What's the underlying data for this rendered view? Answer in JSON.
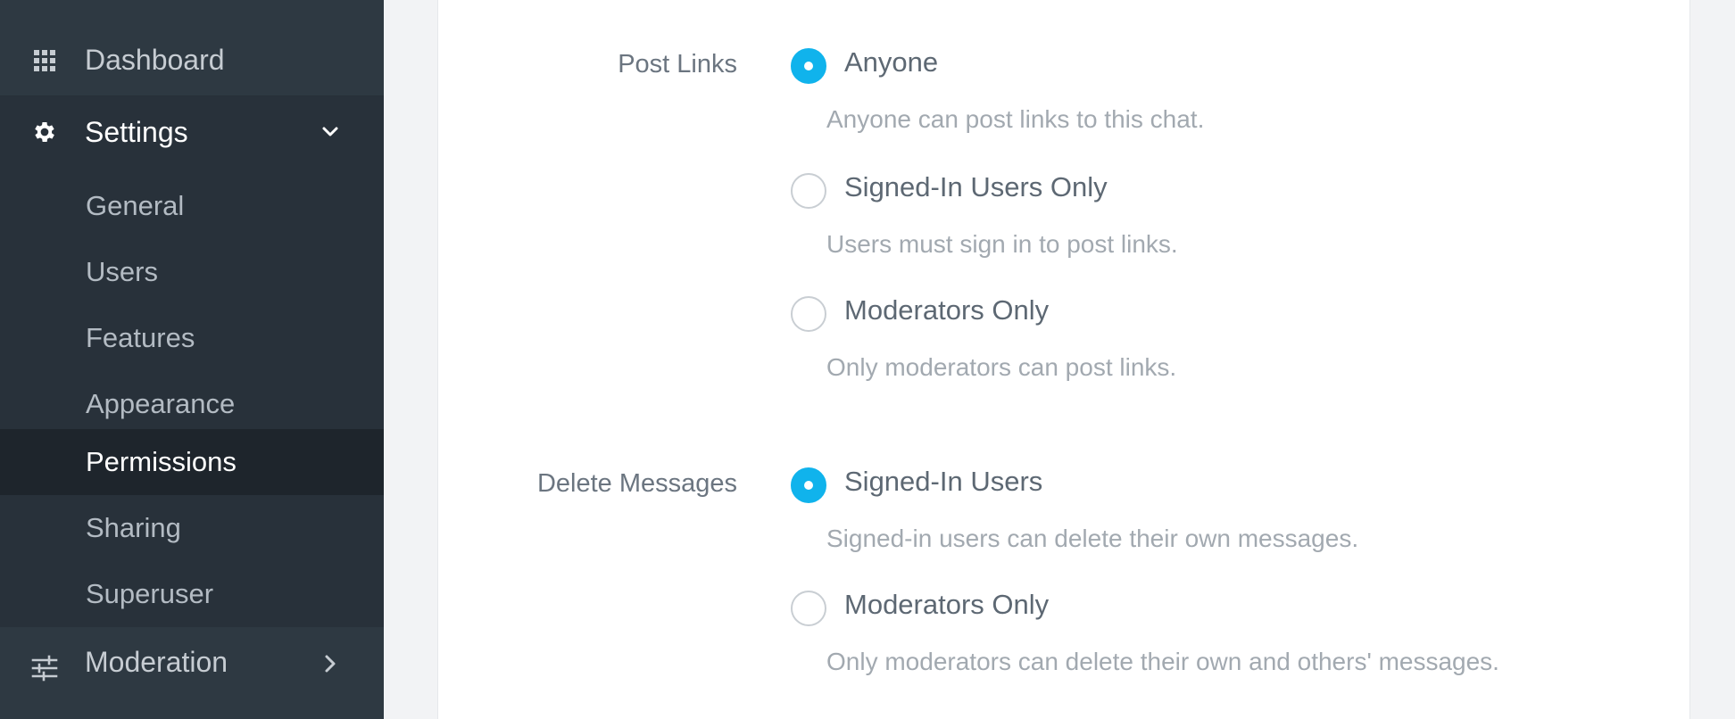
{
  "sidebar": {
    "dashboard": {
      "label": "Dashboard",
      "icon": "grid-icon"
    },
    "settings": {
      "label": "Settings",
      "icon": "gear-icon",
      "expanded": true
    },
    "sub_items": [
      {
        "label": "General"
      },
      {
        "label": "Users"
      },
      {
        "label": "Features"
      },
      {
        "label": "Appearance"
      },
      {
        "label": "Permissions",
        "active": true
      },
      {
        "label": "Sharing"
      },
      {
        "label": "Superuser"
      }
    ],
    "moderation": {
      "label": "Moderation",
      "icon": "sliders-icon"
    }
  },
  "permissions": {
    "post_links": {
      "label": "Post Links",
      "options": [
        {
          "title": "Anyone",
          "description": "Anyone can post links to this chat.",
          "selected": true
        },
        {
          "title": "Signed-In Users Only",
          "description": "Users must sign in to post links.",
          "selected": false
        },
        {
          "title": "Moderators Only",
          "description": "Only moderators can post links.",
          "selected": false
        }
      ]
    },
    "delete_messages": {
      "label": "Delete Messages",
      "options": [
        {
          "title": "Signed-In Users",
          "description": "Signed-in users can delete their own messages.",
          "selected": true
        },
        {
          "title": "Moderators Only",
          "description": "Only moderators can delete their own and others' messages.",
          "selected": false
        }
      ]
    }
  },
  "colors": {
    "sidebar_bg": "#2e3942",
    "submenu_bg": "#28313a",
    "active_bg": "#1e252c",
    "accent": "#10b3ec"
  }
}
